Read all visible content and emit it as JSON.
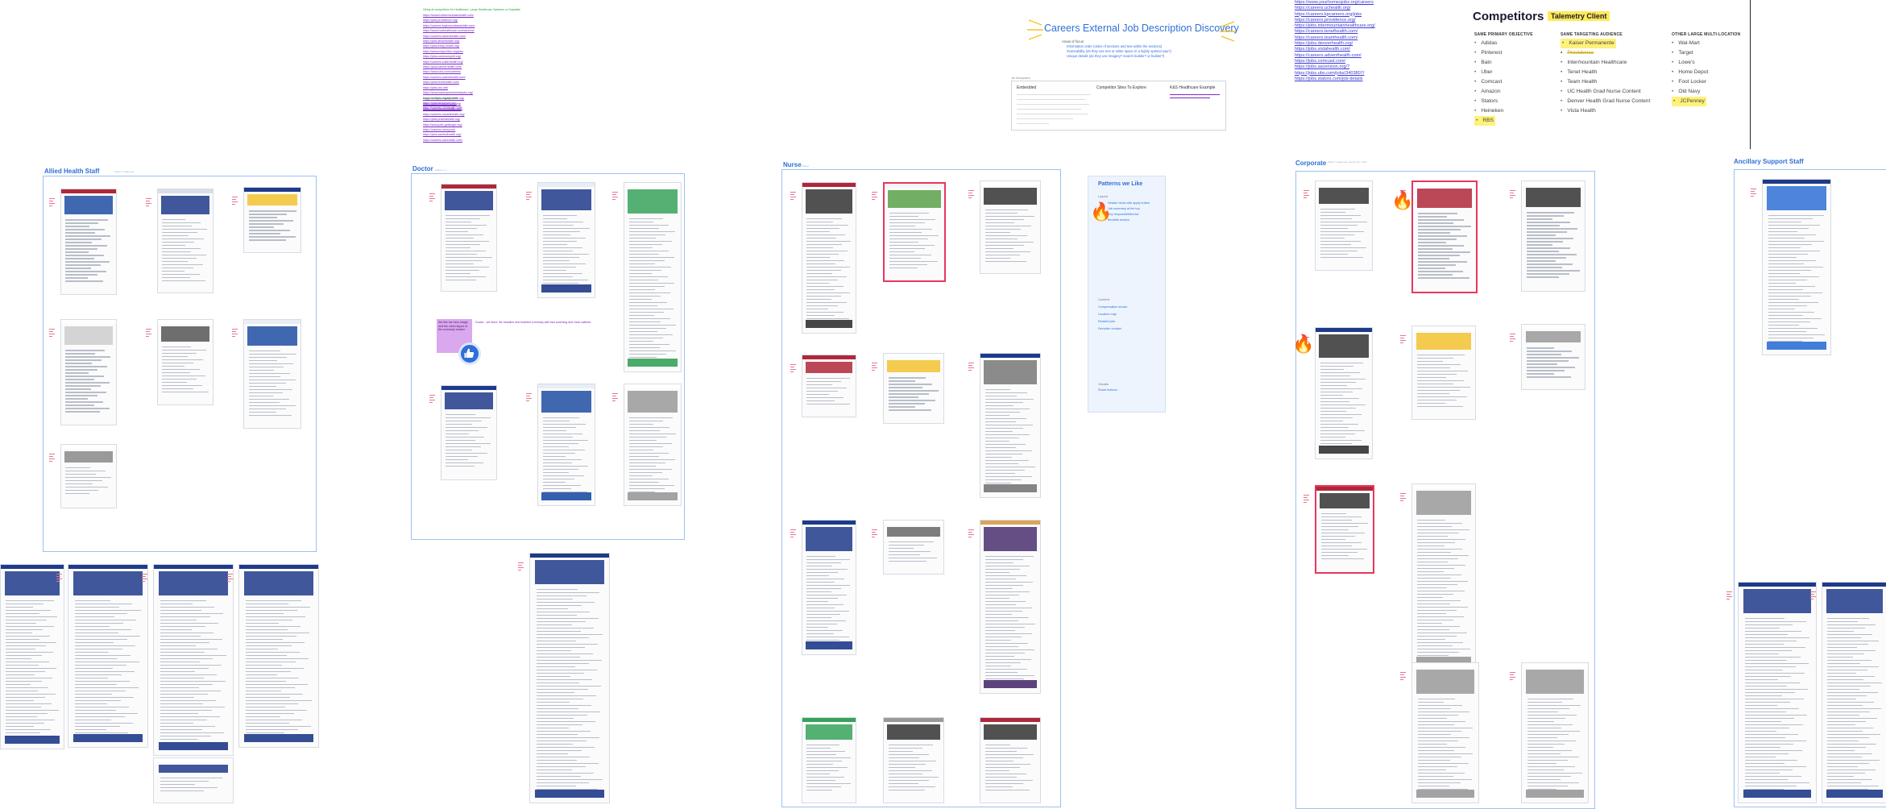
{
  "title_card": {
    "title": "Careers External Job Description Discovery",
    "bullets_head": "Areas of focus:",
    "bullets": [
      "Information order (order of sections and text within the sections)",
      "Scannability (do they use text or white space in a highly optimal way?)",
      "Unique details (do they use imagery? search builder? or builder?)"
    ],
    "table_label": "Job Descriptions",
    "col1": "Embedded",
    "col2": "Competitor Sites To Explore",
    "col3": "K&S Healthcare Example"
  },
  "competitors": {
    "title": "Competitors",
    "tag": "Talemetry Client",
    "col1_head": "SAME PRIMARY OBJECTIVE",
    "col1": [
      "Adidas",
      "Pinterest",
      "Bain",
      "Uber",
      "Comcast",
      "Amazon",
      "Stators",
      "Heineken",
      "RBS"
    ],
    "col2_head": "SAME TARGETING AUDIENCE",
    "col2": [
      "Kaiser Permanente",
      "Providence",
      "Intermountain Healthcare",
      "Tenet Health",
      "Team Health",
      "UC Health Grad Nurse Content",
      "Denver Health Grad Nurse Content",
      "Vista Health"
    ],
    "col3_head": "OTHER LARGE MULTI-LOCATION",
    "col3": [
      "Wal-Mart",
      "Target",
      "Lowe's",
      "Home Depot",
      "Foot Locker",
      "Old Navy",
      "JCPenney"
    ]
  },
  "urls_left": {
    "heading": "Hiring at competitors for Healthcare, Large Healthcare Systems or Hospitals",
    "items": [
      "https://search.intermountainhealth.com/",
      "https://jobs.providence.org/",
      "https://careers.baylorscottandwhite.com/",
      "https://www.hcahealthcare.com/careers/",
      "https://careers.adventhealth.com/",
      "https://jobs.atriumhealth.org/",
      "https://jobs.trinity-health.org/",
      "https://www.mayoclinic.org/jobs",
      "https://jobs.commonspirit.org/",
      "https://careers.sutterhealth.org/",
      "https://jobs.bannerhealth.com/",
      "https://www.uhs.com/careers/",
      "https://careers.ardenthealth.com/",
      "https://jobs.tenethealth.com/",
      "https://jobs.chs.net/",
      "https://www.kaiserpermanentejobs.org/",
      "https://careers.dignityhealth.org/",
      "https://jobs.beaumont.org/",
      "https://careers.ohiohealth.com/"
    ],
    "heading2": "Large or Typical small sites",
    "items2": [
      "https://careers.ascension.org/",
      "https://jobs.lifepointhealth.net/",
      "https://careers.novanthealth.org/",
      "https://jobs.prismahealth.org/",
      "https://www.jobs.geisinger.org/",
      "https://careers.mercy.net/",
      "https://jobs.sanfordhealth.org/",
      "https://careers.ssmhealth.com/"
    ]
  },
  "urls_right": {
    "items": [
      "https://www.yourhomesjobs.org/careers",
      "https://careers.uchealth.org/",
      "https://careers.kpcareers.org/jobs",
      "https://careers.providence.org/",
      "https://jobs.intermountainhealthcare.org/",
      "https://careers.tenethealth.com/",
      "https://careers.teamhealth.com/",
      "https://jobs.denverhealth.org/",
      "https://jobs.vistahealth.com/",
      "https://careers.adventhealth.com/",
      "https://jobs.comcast.com/",
      "https://jobs.ascension.org/?",
      "https://jobs.ubs.com/jobs/3403807/",
      "https://jobs.stators.com/job-details"
    ]
  },
  "frames": {
    "allied": {
      "title": "Allied Health Staff",
      "sub": "Owner: Leslie Lee"
    },
    "doctor": {
      "title": "Doctor",
      "sub": "Owner: L.L."
    },
    "nurse": {
      "title": "Nurse",
      "sub": "Owner"
    },
    "corporate": {
      "title": "Corporate",
      "sub": "Owner: Leslie Lee, Lauren Hu, Chris"
    },
    "ancillary": {
      "title": "Ancillary Support Staff",
      "sub": ""
    }
  },
  "patterns": {
    "title": "Patterns we Like",
    "lines": [
      "Header block with apply button",
      "Job summary at the top",
      "Key responsibilities list",
      "Benefits section",
      "Compensation shown",
      "Location map",
      "Related jobs",
      "Recruiter contact",
      "Share buttons"
    ],
    "sub1": "Layout",
    "sub2": "Content",
    "sub3": "Visuals"
  },
  "doctor_note": {
    "sticky": "We like the hero image and the clean layout of the summary section",
    "text": "Doctor - we liked: the headline and bulleted summary with fast scanning and clear callouts."
  },
  "colors": {
    "frame": "#9cc1f2",
    "highlight": "#e8365d",
    "link": "#7b29c9",
    "accent": "#2f6fd6",
    "yellow": "#ffea57"
  },
  "icons": [
    "fire-icon",
    "thumbs-up-icon",
    "sparkle-icon"
  ]
}
